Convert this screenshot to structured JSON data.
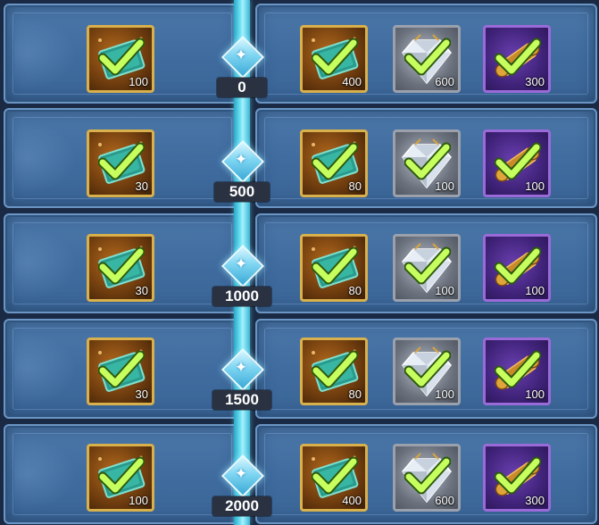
{
  "colors": {
    "panel": "#426e9f",
    "track": "#6fe3f4",
    "checkmark": "#c7ff5e",
    "tier_label_bg": "#2a3140"
  },
  "tiers": [
    {
      "threshold": "0",
      "free_reward": {
        "type": "ticket",
        "amount": "100",
        "claimed": true
      },
      "premium_rewards": [
        {
          "type": "ticket",
          "amount": "400",
          "claimed": true
        },
        {
          "type": "diamond",
          "amount": "600",
          "claimed": true
        },
        {
          "type": "scroll",
          "amount": "300",
          "claimed": true
        }
      ]
    },
    {
      "threshold": "500",
      "free_reward": {
        "type": "ticket",
        "amount": "30",
        "claimed": true
      },
      "premium_rewards": [
        {
          "type": "ticket",
          "amount": "80",
          "claimed": true
        },
        {
          "type": "diamond",
          "amount": "100",
          "claimed": true
        },
        {
          "type": "scroll",
          "amount": "100",
          "claimed": true
        }
      ]
    },
    {
      "threshold": "1000",
      "free_reward": {
        "type": "ticket",
        "amount": "30",
        "claimed": true
      },
      "premium_rewards": [
        {
          "type": "ticket",
          "amount": "80",
          "claimed": true
        },
        {
          "type": "diamond",
          "amount": "100",
          "claimed": true
        },
        {
          "type": "scroll",
          "amount": "100",
          "claimed": true
        }
      ]
    },
    {
      "threshold": "1500",
      "free_reward": {
        "type": "ticket",
        "amount": "30",
        "claimed": true
      },
      "premium_rewards": [
        {
          "type": "ticket",
          "amount": "80",
          "claimed": true
        },
        {
          "type": "diamond",
          "amount": "100",
          "claimed": true
        },
        {
          "type": "scroll",
          "amount": "100",
          "claimed": true
        }
      ]
    },
    {
      "threshold": "2000",
      "free_reward": {
        "type": "ticket",
        "amount": "100",
        "claimed": true
      },
      "premium_rewards": [
        {
          "type": "ticket",
          "amount": "400",
          "claimed": true
        },
        {
          "type": "diamond",
          "amount": "600",
          "claimed": true
        },
        {
          "type": "scroll",
          "amount": "300",
          "claimed": true
        }
      ]
    }
  ]
}
